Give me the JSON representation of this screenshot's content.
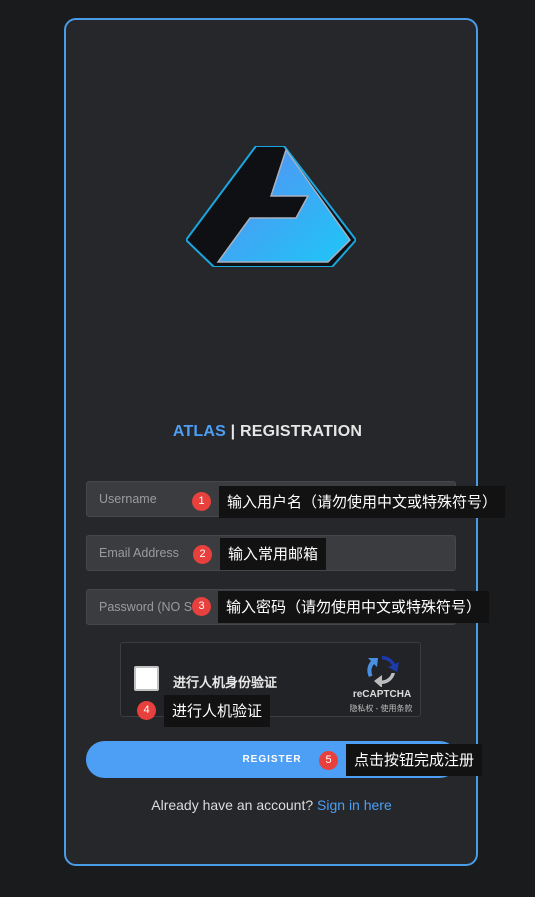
{
  "title": {
    "brand": "ATLAS",
    "separator": " | ",
    "rest": "REGISTRATION"
  },
  "form": {
    "username_placeholder": "Username",
    "email_placeholder": "Email Address",
    "password_placeholder": "Password (NO S.C.",
    "captcha_label": "进行人机身份验证",
    "captcha_brand": "reCAPTCHA",
    "captcha_links": "隐私权 - 使用条款",
    "register_label": "REGISTER"
  },
  "signin": {
    "prompt": "Already have an account? ",
    "link": "Sign in here"
  },
  "annotations": [
    {
      "num": "1",
      "text": "输入用户名（请勿使用中文或特殊符号）"
    },
    {
      "num": "2",
      "text": "输入常用邮箱"
    },
    {
      "num": "3",
      "text": "输入密码（请勿使用中文或特殊符号）"
    },
    {
      "num": "4",
      "text": "进行人机验证"
    },
    {
      "num": "5",
      "text": "点击按钮完成注册"
    }
  ],
  "colors": {
    "accent": "#4d9ef5",
    "annotation_dot": "#e8403d",
    "card_border": "#4a9be8"
  }
}
